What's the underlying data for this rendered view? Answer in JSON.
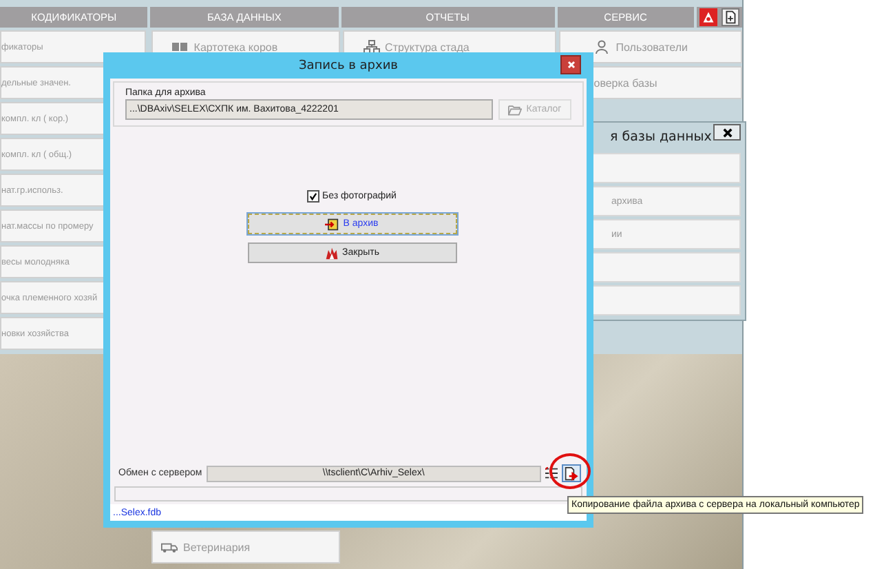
{
  "app": {
    "header": [
      {
        "label": "КОДИФИКАТОРЫ"
      },
      {
        "label": "БАЗА ДАННЫХ"
      },
      {
        "label": "ОТЧЕТЫ"
      },
      {
        "label": "СЕРВИС"
      }
    ],
    "columns": [
      {
        "items": [
          "фикаторы",
          "дельные значен.",
          "компл. кл ( кор.)",
          "компл. кл ( общ.)",
          "нат.гр.использ.",
          "нат.массы по промеру",
          "весы молодняка",
          "очка племенного хозяй",
          "новки хозяйства"
        ]
      },
      {
        "items": [
          "Картотека коров"
        ]
      },
      {
        "items": [
          "Структура стада"
        ]
      },
      {
        "items": [
          "Пользователи",
          "оверка базы"
        ]
      }
    ],
    "bottom_item": "Ветеринария"
  },
  "db_window": {
    "title": "я базы данных",
    "items": [
      {
        "kind": "blank"
      },
      {
        "kind": "text",
        "label": "архива"
      },
      {
        "kind": "text",
        "label": "ии"
      },
      {
        "kind": "blank"
      },
      {
        "kind": "blank"
      }
    ]
  },
  "dialog": {
    "title": "Запись в архив",
    "folder_label": "Папка для архива",
    "folder_path": "...\\DBAxiv\\SELEX\\СХПК им. Вахитова_4222201",
    "catalog_button": "Каталог",
    "without_photos": {
      "label": "Без фотографий",
      "checked": true
    },
    "archive_button": "В архив",
    "close_button": "Закрыть",
    "server_label": "Обмен с сервером",
    "server_path": "\\\\tsclient\\C\\Arhiv_Selex\\",
    "status_link": "...Selex.fdb",
    "progress": {
      "level": 0
    }
  },
  "tooltip": "Копирование файла архива с сервера на локальный компьютер"
}
